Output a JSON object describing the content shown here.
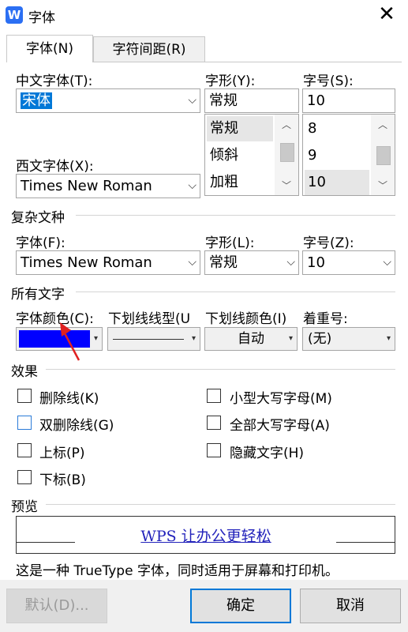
{
  "window": {
    "title": "字体",
    "app_icon": "W",
    "close_glyph": "✕"
  },
  "tabs": [
    {
      "label": "字体(N)",
      "active": true
    },
    {
      "label": "字符间距(R)",
      "active": false
    }
  ],
  "chinese_font": {
    "label": "中文字体(T):",
    "value": "宋体"
  },
  "western_font": {
    "label": "西文字体(X):",
    "value": "Times New Roman"
  },
  "style": {
    "label": "字形(Y):",
    "value": "常规",
    "options": [
      "常规",
      "倾斜",
      "加粗"
    ],
    "selected_index": 0
  },
  "size": {
    "label": "字号(S):",
    "value": "10",
    "options": [
      "8",
      "9",
      "10"
    ],
    "selected_index": 2
  },
  "complex": {
    "section": "复杂文种",
    "font_label": "字体(F):",
    "font_value": "Times New Roman",
    "style_label": "字形(L):",
    "style_value": "常规",
    "size_label": "字号(Z):",
    "size_value": "10"
  },
  "all_text": {
    "section": "所有文字",
    "color_label": "字体颜色(C):",
    "color_value": "#0000ff",
    "underline_label": "下划线线型(U",
    "underline_color_label": "下划线颜色(I)",
    "underline_color_value": "自动",
    "emphasis_label": "着重号:",
    "emphasis_value": "(无)"
  },
  "effects": {
    "section": "效果",
    "strikethrough": "删除线(K)",
    "double_strikethrough": "双删除线(G)",
    "superscript": "上标(P)",
    "subscript": "下标(B)",
    "small_caps": "小型大写字母(M)",
    "all_caps": "全部大写字母(A)",
    "hidden": "隐藏文字(H)"
  },
  "preview": {
    "section": "预览",
    "sample": "WPS 让办公更轻松",
    "note": "这是一种 TrueType 字体，同时适用于屏幕和打印机。"
  },
  "buttons": {
    "default": "默认(D)...",
    "ok": "确定",
    "cancel": "取消"
  },
  "colors": {
    "accent": "#0078d7",
    "preview_text": "#2222bb"
  }
}
